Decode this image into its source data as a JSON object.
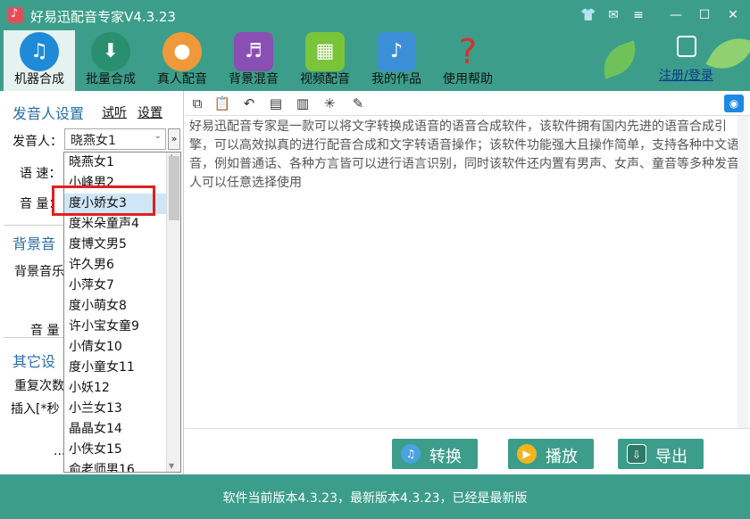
{
  "window": {
    "title": "好易迅配音专家V4.3.23",
    "buttons": [
      "shirt-icon",
      "mail-icon",
      "menu-icon",
      "minimize-icon",
      "maximize-icon",
      "close-icon"
    ]
  },
  "toolbar": {
    "items": [
      {
        "label": "机器合成",
        "icon": "music-note-icon",
        "active": true
      },
      {
        "label": "批量合成",
        "icon": "batch-file-icon",
        "active": false
      },
      {
        "label": "真人配音",
        "icon": "person-icon",
        "active": false
      },
      {
        "label": "背景混音",
        "icon": "equalizer-icon",
        "active": false
      },
      {
        "label": "视频配音",
        "icon": "film-icon",
        "active": false
      },
      {
        "label": "我的作品",
        "icon": "music-works-icon",
        "active": false
      },
      {
        "label": "使用帮助",
        "icon": "question-icon",
        "active": false
      }
    ],
    "register": "注册/登录"
  },
  "left": {
    "speaker_title": "发音人设置",
    "listen": "试听",
    "settings": "设置",
    "speaker_label": "发音人：",
    "speaker_value": "晓燕女1",
    "speed_label": "语 速：",
    "volume_label": "音 量：",
    "bg_title": "背景音",
    "bg_music_label": "背景音乐",
    "bg_volume_label": "音 量",
    "other_title": "其它设",
    "repeat_label": "重复次数",
    "insert_label": "插入[*秒",
    "dots": "..."
  },
  "dropdown": {
    "items": [
      "晓燕女1",
      "小峰男2",
      "度小娇女3",
      "度米朵童声4",
      "度博文男5",
      "许久男6",
      "小萍女7",
      "度小萌女8",
      "许小宝女童9",
      "小倩女10",
      "度小童女11",
      "小妖12",
      "小兰女13",
      "晶晶女14",
      "小佚女15",
      "俞老师男16"
    ],
    "selected_index": 2
  },
  "editor": {
    "text": "好易迅配音专家是一款可以将文字转换成语音的语音合成软件，该软件拥有国内先进的语音合成引擎，可以高效拟真的进行配音合成和文字转语音操作；该软件功能强大且操作简单，支持各种中文语音，例如普通话、各种方言皆可以进行语言识别，同时该软件还内置有男声、女声、童音等多种发音人可以任意选择使用"
  },
  "actions": {
    "convert": "转换",
    "play": "播放",
    "export": "导出"
  },
  "status": {
    "text": "软件当前版本4.3.23，最新版本4.3.23，已经是最新版"
  },
  "colors": {
    "primary": "#3c9e8a",
    "highlight": "#e02020",
    "link": "#0b3a8a"
  }
}
